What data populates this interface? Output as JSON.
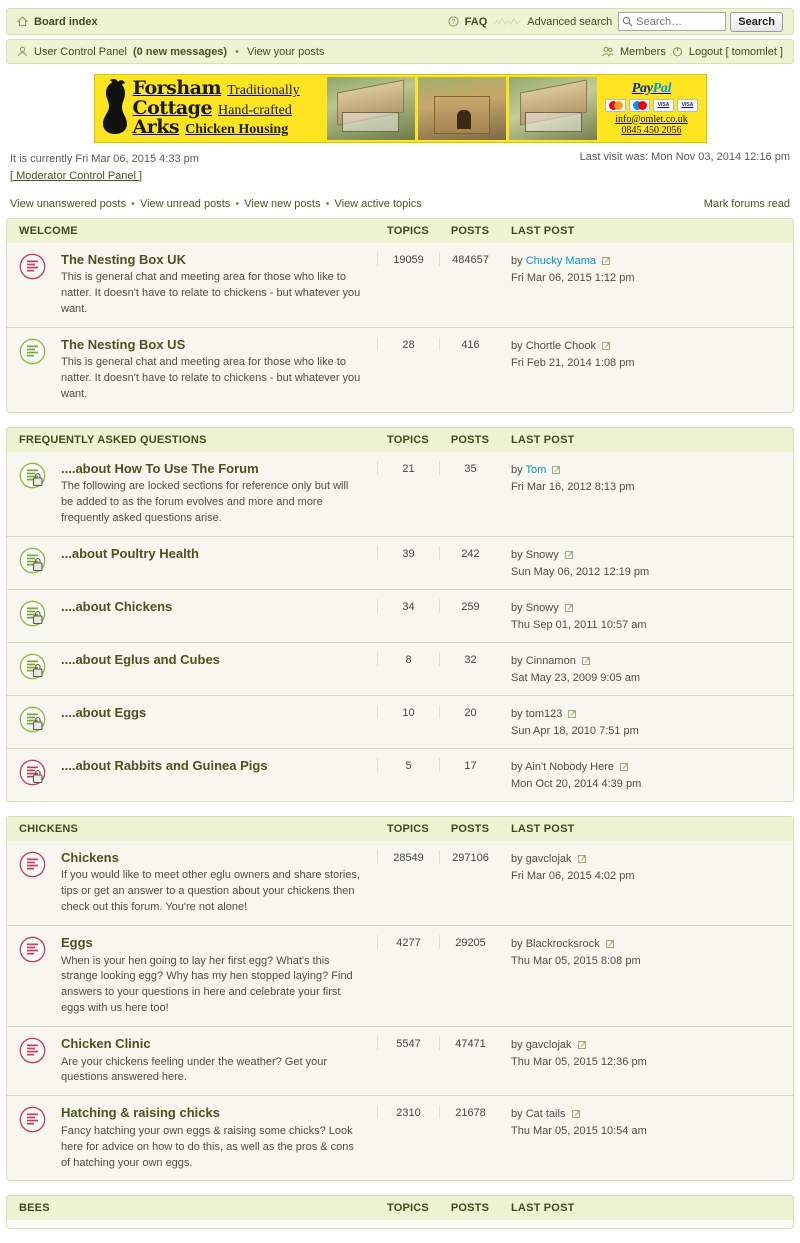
{
  "header": {
    "board_index": "Board index",
    "faq": "FAQ",
    "advanced_search": "Advanced search",
    "search_placeholder": "Search…",
    "search_button": "Search",
    "ucp": "User Control Panel",
    "ucp_messages": "(0 new messages)",
    "view_your_posts": "View your posts",
    "members": "Members",
    "logout": "Logout [ tomomlet ]",
    "dot": "•"
  },
  "banner": {
    "brand_line1": "Forsham",
    "brand_line2": "Cottage",
    "brand_line3": "Arks",
    "tag_line1": "Traditionally",
    "tag_line2": "Hand-crafted",
    "tag_line3": "Chicken Housing",
    "paypal_pay": "Pay",
    "paypal_pal": "Pal",
    "cards": [
      "MasterCard",
      "Maestro",
      "VISA",
      "VISA Electron"
    ],
    "email": "info@omlet.co.uk",
    "phone": "0845 450 2056"
  },
  "info": {
    "current_time": "It is currently Fri Mar 06, 2015 4:33 pm",
    "moderator_cp": "[ Moderator Control Panel ]",
    "last_visit": "Last visit was: Mon Nov 03, 2014 12:16 pm"
  },
  "quicklinks": {
    "unanswered": "View unanswered posts",
    "unread": "View unread posts",
    "new": "View new posts",
    "active": "View active topics",
    "mark_read": "Mark forums read",
    "sep": "•"
  },
  "columns": {
    "topics": "TOPICS",
    "posts": "POSTS",
    "last_post": "LAST POST"
  },
  "by_label": "by",
  "blocks": [
    {
      "title": "WELCOME",
      "forums": [
        {
          "icon": "forum-unread-icon",
          "locked": false,
          "name": "The Nesting Box UK",
          "desc": "This is general chat and meeting area for those who like to natter. It doesn't have to relate to chickens - but whatever you want.",
          "topics": "19059",
          "posts": "484657",
          "last_author": "Chucky Mama",
          "author_link": true,
          "last_date": "Fri Mar 06, 2015 1:12 pm"
        },
        {
          "icon": "forum-read-icon",
          "locked": false,
          "name": "The Nesting Box US",
          "desc": "This is general chat and meeting area for those who like to natter. It doesn't have to relate to chickens - but whatever you want.",
          "topics": "28",
          "posts": "416",
          "last_author": "Chortle Chook",
          "author_link": false,
          "last_date": "Fri Feb 21, 2014 1:08 pm"
        }
      ]
    },
    {
      "title": "FREQUENTLY ASKED QUESTIONS",
      "forums": [
        {
          "icon": "forum-locked-read-icon",
          "locked": true,
          "name": "....about How To Use The Forum",
          "desc": "The following are locked sections for reference only but will be added to as the forum evolves and more and more frequently asked questions arise.",
          "topics": "21",
          "posts": "35",
          "last_author": "Tom",
          "author_link": true,
          "last_date": "Fri Mar 16, 2012 8:13 pm"
        },
        {
          "icon": "forum-locked-read-icon",
          "locked": true,
          "name": "...about Poultry Health",
          "desc": "",
          "topics": "39",
          "posts": "242",
          "last_author": "Snowy",
          "author_link": false,
          "last_date": "Sun May 06, 2012 12:19 pm"
        },
        {
          "icon": "forum-locked-read-icon",
          "locked": true,
          "name": "....about Chickens",
          "desc": "",
          "topics": "34",
          "posts": "259",
          "last_author": "Snowy",
          "author_link": false,
          "last_date": "Thu Sep 01, 2011 10:57 am"
        },
        {
          "icon": "forum-locked-read-icon",
          "locked": true,
          "name": "....about Eglus and Cubes",
          "desc": "",
          "topics": "8",
          "posts": "32",
          "last_author": "Cinnamon",
          "author_link": false,
          "last_date": "Sat May 23, 2009 9:05 am"
        },
        {
          "icon": "forum-locked-read-icon",
          "locked": true,
          "name": "....about Eggs",
          "desc": "",
          "topics": "10",
          "posts": "20",
          "last_author": "tom123",
          "author_link": false,
          "last_date": "Sun Apr 18, 2010 7:51 pm"
        },
        {
          "icon": "forum-locked-unread-icon",
          "locked": true,
          "name": "....about Rabbits and Guinea Pigs",
          "desc": "",
          "topics": "5",
          "posts": "17",
          "last_author": "Ain't Nobody Here",
          "author_link": false,
          "last_date": "Mon Oct 20, 2014 4:39 pm"
        }
      ]
    },
    {
      "title": "CHICKENS",
      "forums": [
        {
          "icon": "forum-unread-icon",
          "locked": false,
          "name": "Chickens",
          "desc": "If you would like to meet other eglu owners and share stories, tips or get an answer to a question about your chickens then check out this forum. You're not alone!",
          "topics": "28549",
          "posts": "297106",
          "last_author": "gavclojak",
          "author_link": false,
          "last_date": "Fri Mar 06, 2015 4:02 pm"
        },
        {
          "icon": "forum-unread-icon",
          "locked": false,
          "name": "Eggs",
          "desc": "When is your hen going to lay her first egg? What's this strange looking egg? Why has my hen stopped laying? Find answers to your questions in here and celebrate your first eggs with us here too!",
          "topics": "4277",
          "posts": "29205",
          "last_author": "Blackrocksrock",
          "author_link": false,
          "last_date": "Thu Mar 05, 2015 8:08 pm"
        },
        {
          "icon": "forum-unread-icon",
          "locked": false,
          "name": "Chicken Clinic",
          "desc": "Are your chickens feeling under the weather? Get your questions answered here.",
          "topics": "5547",
          "posts": "47471",
          "last_author": "gavclojak",
          "author_link": false,
          "last_date": "Thu Mar 05, 2015 12:36 pm"
        },
        {
          "icon": "forum-unread-icon",
          "locked": false,
          "name": "Hatching & raising chicks",
          "desc": "Fancy hatching your own eggs & raising some chicks? Look here for advice on how to do this, as well as the pros & cons of hatching your own eggs.",
          "topics": "2310",
          "posts": "21678",
          "last_author": "Cat tails",
          "author_link": false,
          "last_date": "Thu Mar 05, 2015 10:54 am"
        }
      ]
    },
    {
      "title": "BEES",
      "forums": []
    }
  ]
}
